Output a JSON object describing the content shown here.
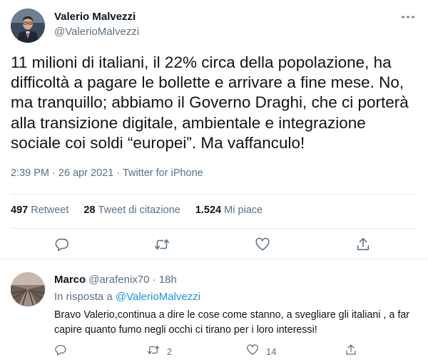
{
  "tweet": {
    "author_name": "Valerio Malvezzi",
    "author_handle": "@ValerioMalvezzi",
    "text": "11 milioni di italiani, il 22% circa della popolazione, ha difficoltà a pagare le bollette e arrivare a fine mese. No, ma tranquillo; abbiamo il Governo Draghi, che ci porterà alla transizione digitale, ambientale e integrazione sociale coi soldi “europei”. Ma vaffanculo!",
    "time": "2:39 PM",
    "date": "26 apr 2021",
    "source": "Twitter for iPhone",
    "separator": " · ",
    "stats": {
      "retweets_count": "497",
      "retweets_label": "Retweet",
      "quotes_count": "28",
      "quotes_label": "Tweet di citazione",
      "likes_count": "1.524",
      "likes_label": "Mi piace"
    }
  },
  "reply": {
    "author_name": "Marco",
    "author_handle": "@arafenix70",
    "separator": " · ",
    "time_ago": "18h",
    "reply_to_label": "In risposta a",
    "reply_to_mention": "@ValerioMalvezzi",
    "text": "Bravo Valerio,continua a dire le cose come stanno, a svegliare gli italiani , a far capire quanto fumo negli occhi ci tirano per i loro interessi!",
    "retweets_count": "2",
    "likes_count": "14"
  },
  "icons": {
    "more": "more-icon",
    "reply": "reply-icon",
    "retweet": "retweet-icon",
    "like": "heart-icon",
    "share": "share-icon"
  },
  "colors": {
    "text_primary": "#0f1419",
    "text_secondary": "#5b7083",
    "link": "#1b95e0",
    "divider": "#e6ecf0"
  }
}
